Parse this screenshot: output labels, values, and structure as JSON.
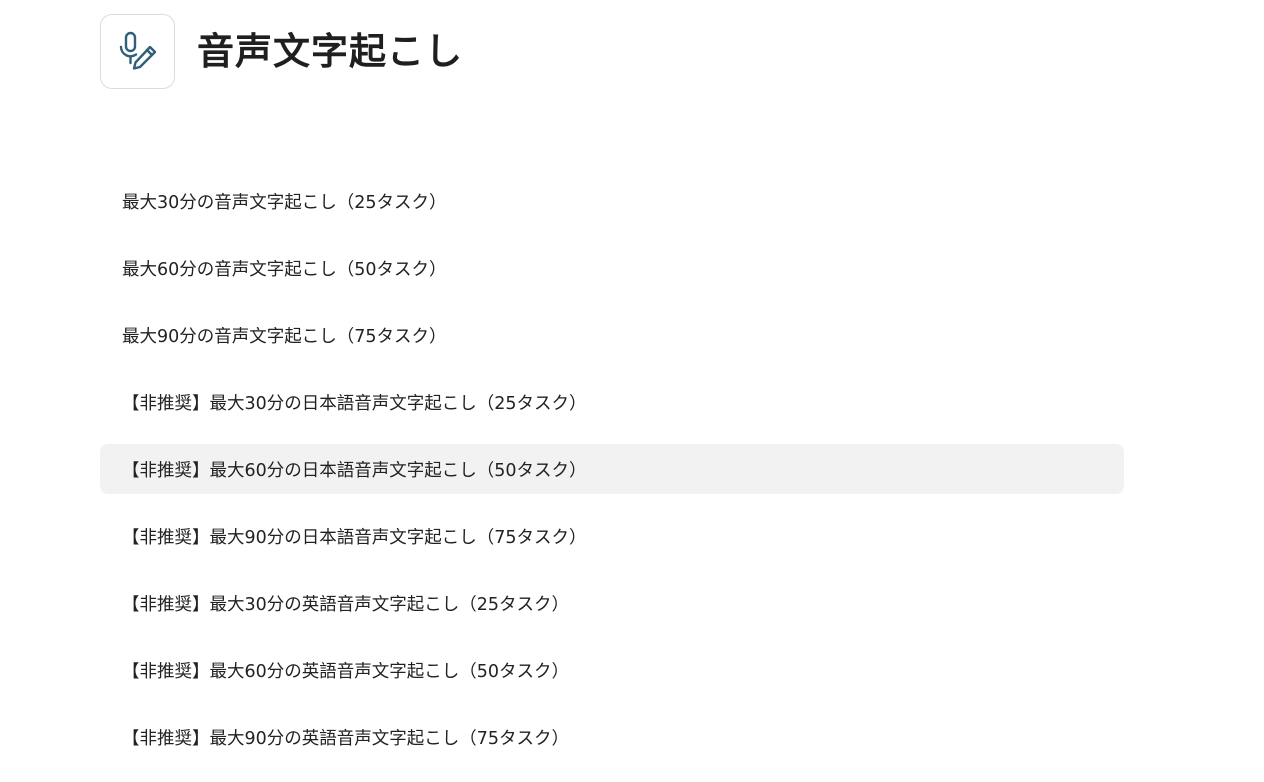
{
  "header": {
    "icon": "microphone-pen-icon",
    "title": "音声文字起こし"
  },
  "options": [
    {
      "label": "最大30分の音声文字起こし（25タスク）"
    },
    {
      "label": "最大60分の音声文字起こし（50タスク）"
    },
    {
      "label": "最大90分の音声文字起こし（75タスク）"
    },
    {
      "label": "【非推奨】最大30分の日本語音声文字起こし（25タスク）"
    },
    {
      "label": "【非推奨】最大60分の日本語音声文字起こし（50タスク）"
    },
    {
      "label": "【非推奨】最大90分の日本語音声文字起こし（75タスク）"
    },
    {
      "label": "【非推奨】最大30分の英語音声文字起こし（25タスク）"
    },
    {
      "label": "【非推奨】最大60分の英語音声文字起こし（50タスク）"
    },
    {
      "label": "【非推奨】最大90分の英語音声文字起こし（75タスク）"
    }
  ],
  "colors": {
    "icon_stroke": "#2f5f7a",
    "hover_bg": "#f2f2f2",
    "text": "#222222"
  }
}
